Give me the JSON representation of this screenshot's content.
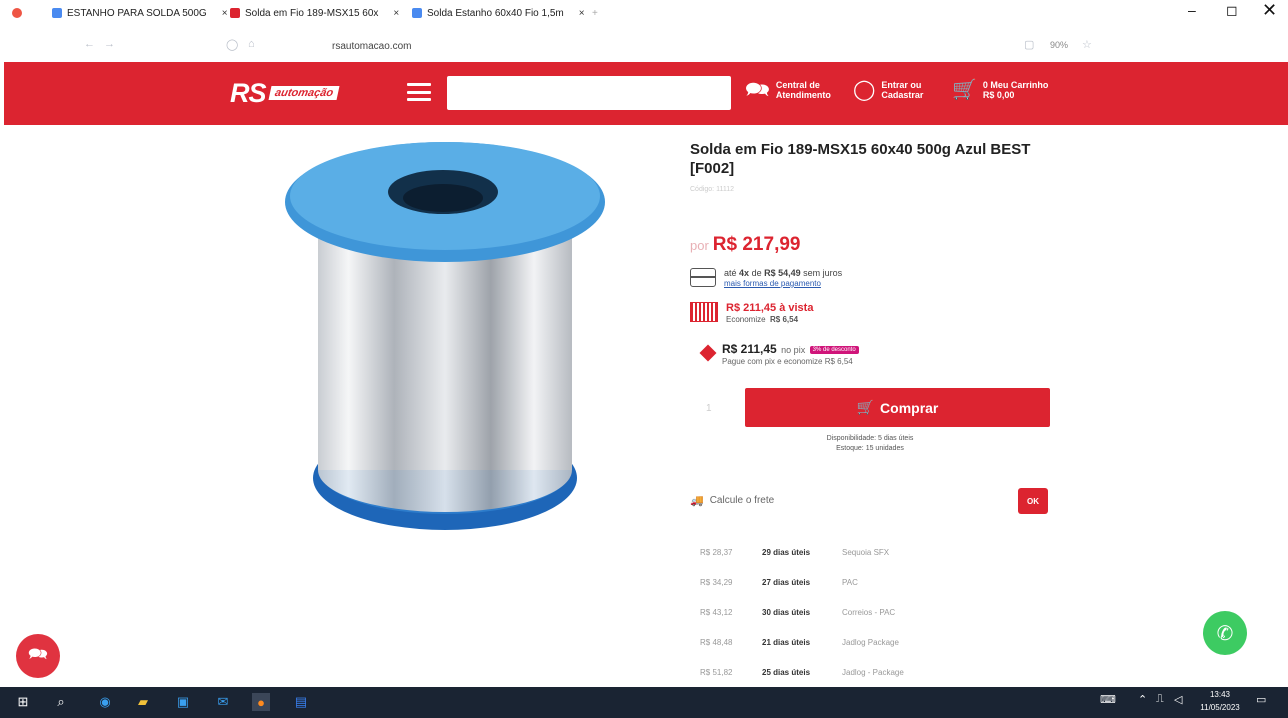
{
  "browser": {
    "tabs": [
      {
        "label": "ESTANHO PARA SOLDA 500G",
        "close": "×"
      },
      {
        "label": "Solda em Fio 189-MSX15 60x",
        "close": "×"
      },
      {
        "label": "Solda Estanho 60x40 Fio 1,5m",
        "close": "×"
      }
    ],
    "new_tab": "+",
    "url": "rsautomacao.com",
    "zoom": "90%",
    "minimize": "–",
    "restore": "◻"
  },
  "header": {
    "logo_rs": "RS",
    "logo_sub": "automação",
    "central": {
      "line1": "Central de",
      "line2": "Atendimento"
    },
    "login": {
      "line1": "Entrar ou",
      "line2": "Cadastrar"
    },
    "cart": {
      "line1": "0  Meu Carrinho",
      "line2": "R$ 0,00"
    }
  },
  "product": {
    "title": "Solda em Fio 189-MSX15 60x40 500g Azul BEST [F002]",
    "code": "Código: 11112",
    "price_prefix": "por",
    "price": "R$ 217,99",
    "installments": {
      "prefix": "até",
      "times": "4x",
      "mid": "de",
      "value": "R$ 54,49",
      "suffix": "sem juros",
      "link": "mais formas de pagamento"
    },
    "cash": {
      "price": "R$ 211,45 à vista",
      "savings_label": "Economize",
      "savings": "R$ 6,54"
    },
    "pix": {
      "price": "R$ 211,45",
      "suffix": "no pix",
      "badge": "3% de desconto",
      "note": "Pague com pix e economize R$ 6,54"
    },
    "qty": "1",
    "buy_label": "Comprar",
    "availability": "Disponibilidade: 5 dias úteis",
    "stock": "Estoque: 15 unidades"
  },
  "shipping": {
    "calc_label": "Calcule o frete",
    "ok_label": "OK",
    "rows": [
      {
        "price": "R$ 28,37",
        "days": "29 dias úteis",
        "carrier": "Sequoia SFX"
      },
      {
        "price": "R$ 34,29",
        "days": "27 dias úteis",
        "carrier": "PAC"
      },
      {
        "price": "R$ 43,12",
        "days": "30 dias úteis",
        "carrier": "Correios - PAC"
      },
      {
        "price": "R$ 48,48",
        "days": "21 dias úteis",
        "carrier": "Jadlog Package"
      },
      {
        "price": "R$ 51,82",
        "days": "25 dias úteis",
        "carrier": "Jadlog - Package"
      }
    ]
  },
  "taskbar": {
    "time": "13:43",
    "date": "11/05/2023"
  },
  "colors": {
    "brand_red": "#dc2430",
    "whatsapp": "#3dcb62",
    "taskbar": "#1a2433"
  }
}
